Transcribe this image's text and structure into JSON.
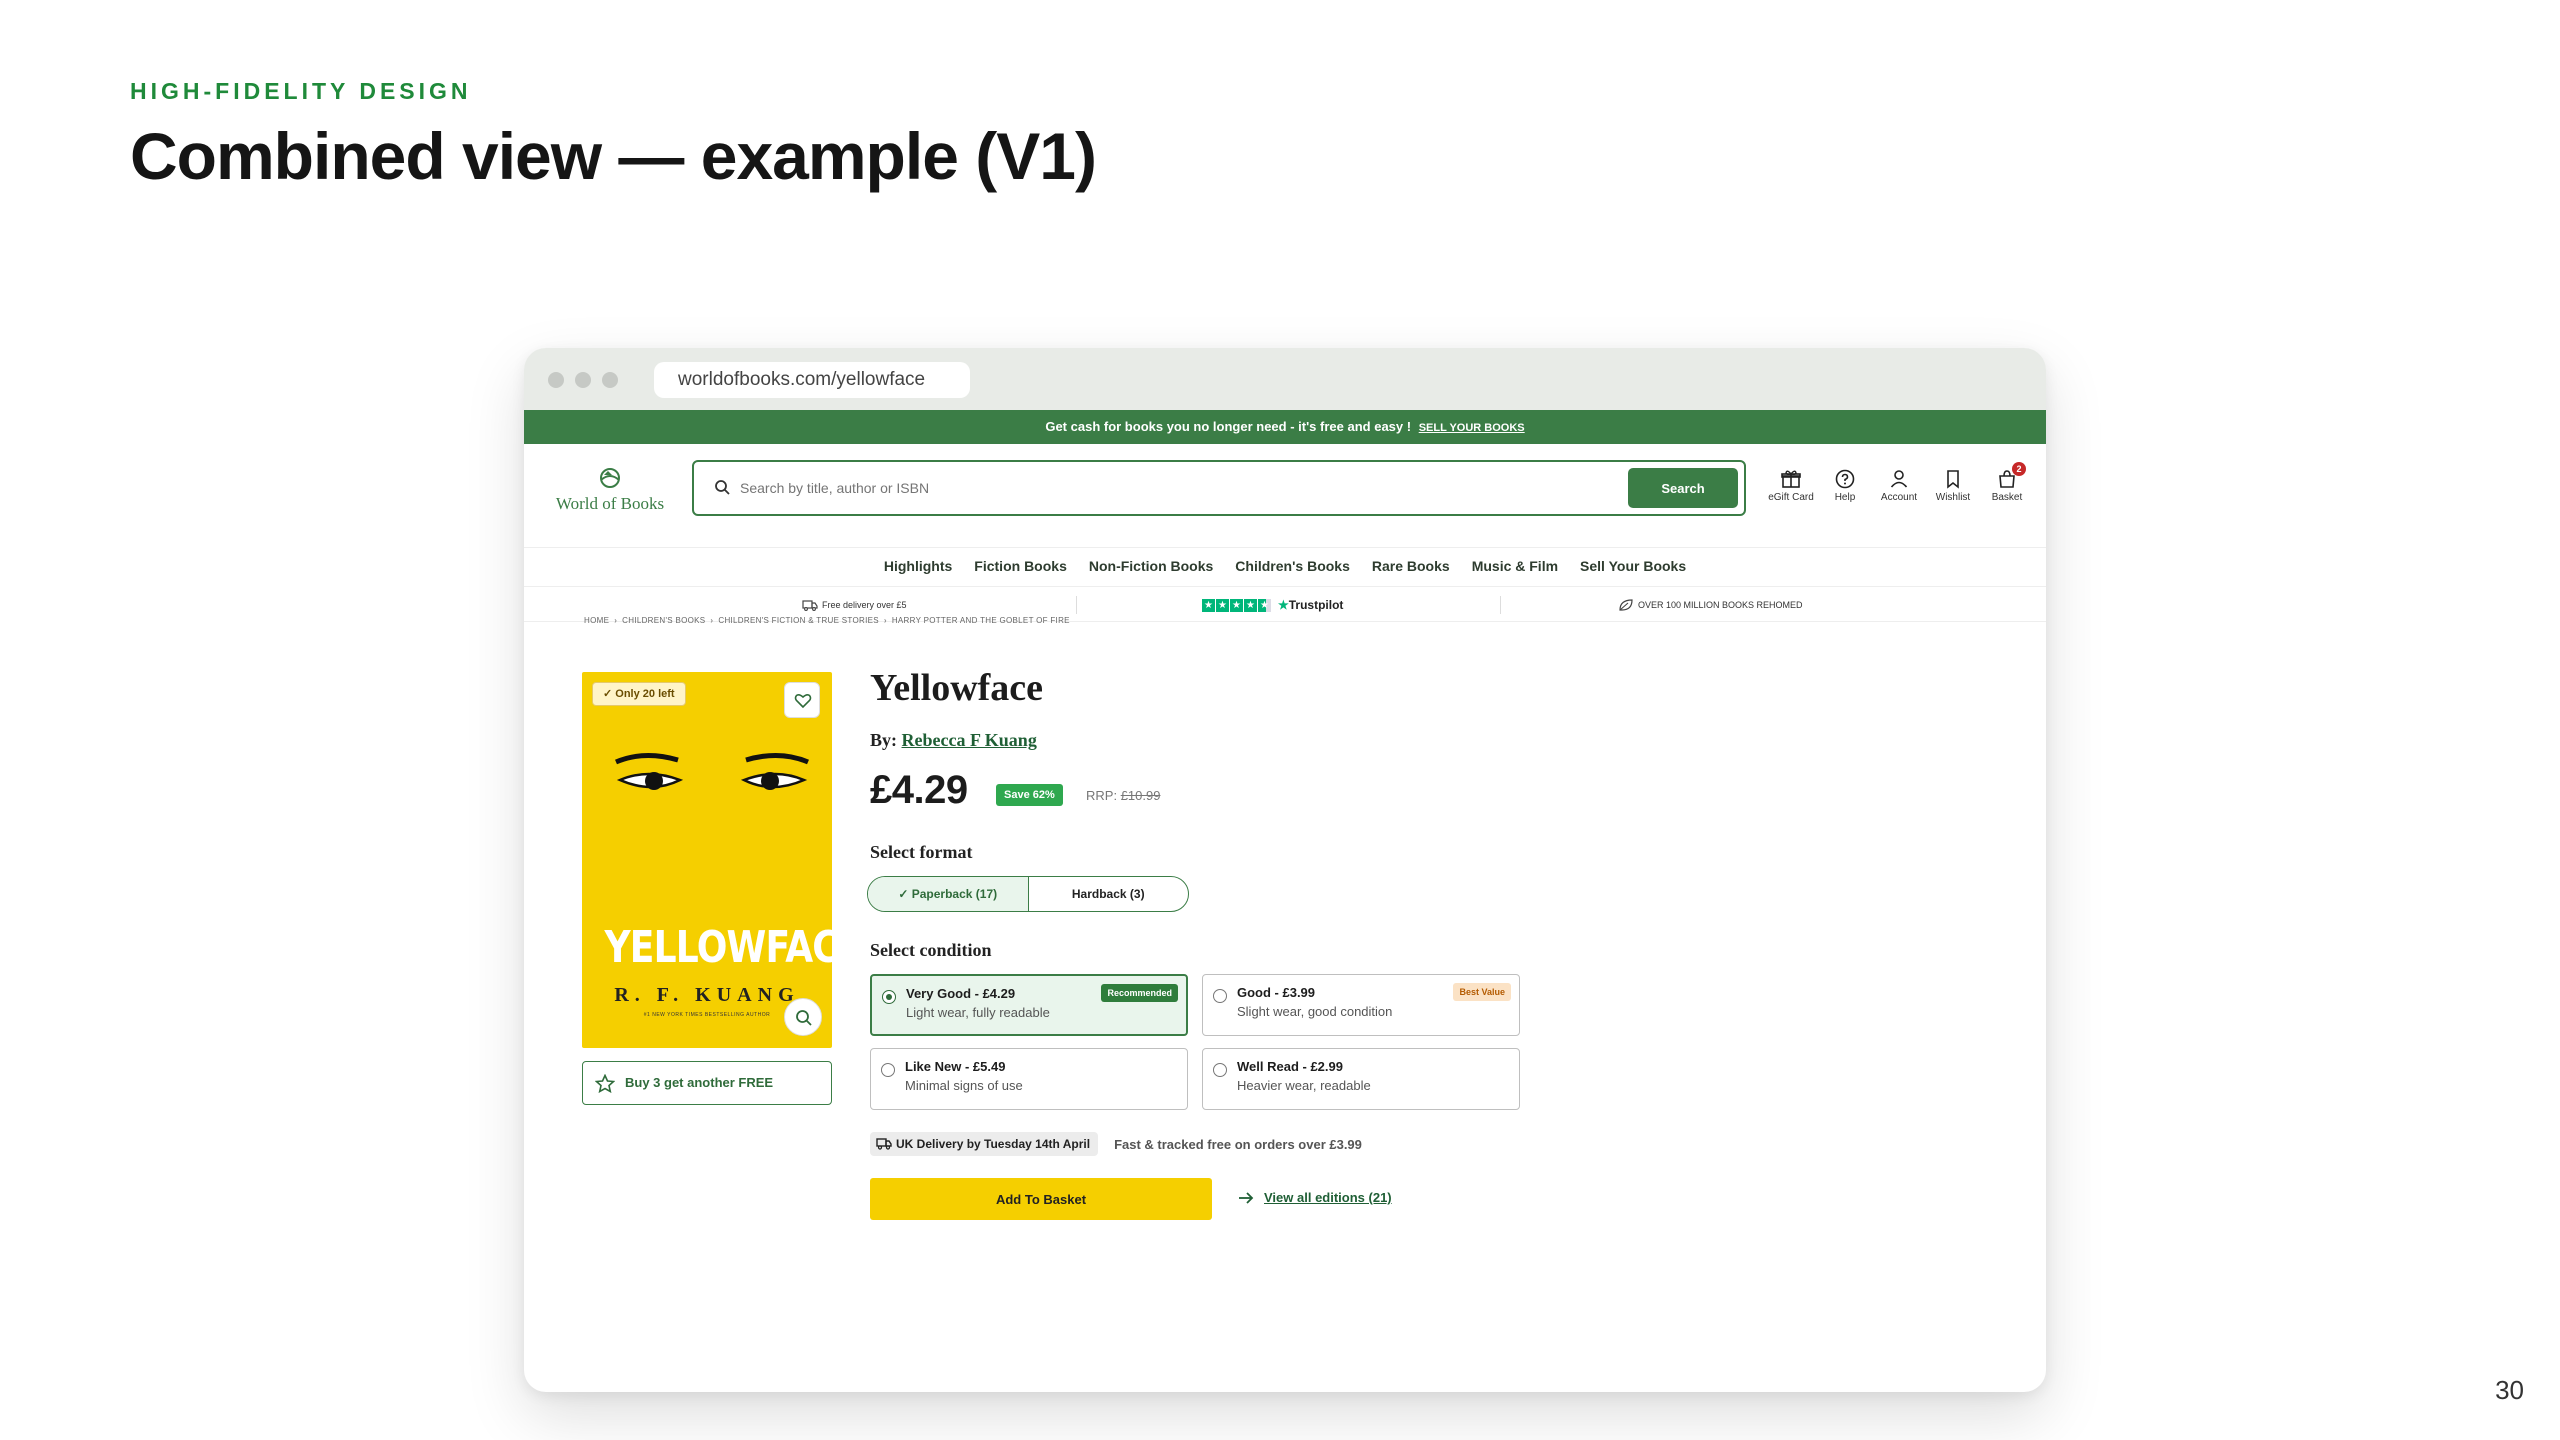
{
  "slide": {
    "eyebrow": "HIGH-FIDELITY DESIGN",
    "title": "Combined view — example (V1)",
    "page_number": "30"
  },
  "browser": {
    "url": "worldofbooks.com/yellowface"
  },
  "promo_banner": {
    "text": "Get cash for books you no longer need - it's free and easy !",
    "link": "SELL YOUR BOOKS"
  },
  "header": {
    "logo_text": "World of Books",
    "search_placeholder": "Search by title, author or ISBN",
    "search_button": "Search",
    "icons": [
      {
        "label": "eGift Card",
        "icon": "gift-icon"
      },
      {
        "label": "Help",
        "icon": "help-icon"
      },
      {
        "label": "Account",
        "icon": "account-icon"
      },
      {
        "label": "Wishlist",
        "icon": "bookmark-icon"
      },
      {
        "label": "Basket",
        "icon": "basket-icon"
      }
    ],
    "basket_count": "2"
  },
  "nav": {
    "items": [
      "Highlights",
      "Fiction Books",
      "Non-Fiction Books",
      "Children's Books",
      "Rare Books",
      "Music & Film",
      "Sell Your Books"
    ]
  },
  "trust_bar": {
    "delivery": "Free delivery over £5",
    "trustpilot": "Trustpilot",
    "rehomed": "OVER 100 MILLION BOOKS REHOMED"
  },
  "breadcrumbs": [
    "HOME",
    "CHILDREN'S BOOKS",
    "CHILDREN'S FICTION & TRUE STORIES",
    "HARRY POTTER AND THE GOBLET OF FIRE"
  ],
  "product": {
    "stock_badge": "Only 20 left",
    "cover_title": "YELLOWFACE",
    "cover_author": "R. F. KUANG",
    "cover_tagline": "#1 NEW YORK TIMES BESTSELLING AUTHOR",
    "offer": "Buy 3 get another FREE",
    "title": "Yellowface",
    "by_label": "By:",
    "author": "Rebecca F Kuang",
    "price": "£4.29",
    "save_badge": "Save 62%",
    "rrp_label": "RRP:",
    "rrp_value": "£10.99",
    "format_label": "Select format",
    "formats": [
      "Paperback (17)",
      "Hardback (3)"
    ],
    "condition_label": "Select condition",
    "conditions": [
      {
        "title": "Very Good - £4.29",
        "sub": "Light wear, fully readable",
        "badge": "Recommended"
      },
      {
        "title": "Good - £3.99",
        "sub": "Slight wear, good condition",
        "badge": "Best Value"
      },
      {
        "title": "Like New - £5.49",
        "sub": "Minimal signs of use"
      },
      {
        "title": "Well Read - £2.99",
        "sub": "Heavier wear, readable"
      }
    ],
    "delivery_pill": "UK Delivery by Tuesday 14th April",
    "delivery_note": "Fast & tracked free on orders over £3.99",
    "add_button": "Add To Basket",
    "editions_link": "View all editions (21)"
  },
  "colors": {
    "brand_green": "#3b7d46",
    "accent_yellow": "#f5cf00",
    "eyebrow_green": "#1f8a3a"
  }
}
